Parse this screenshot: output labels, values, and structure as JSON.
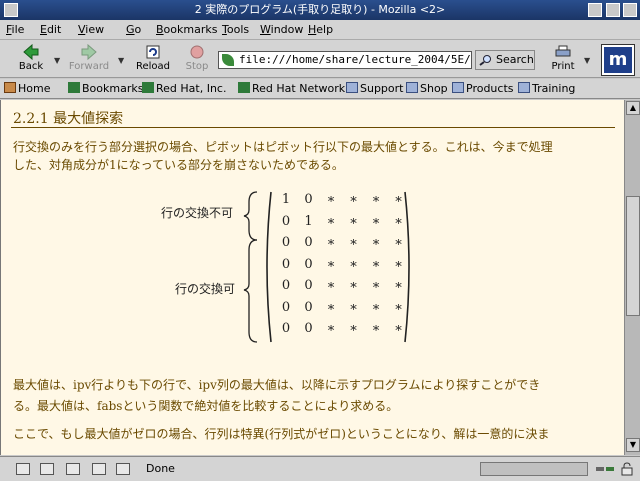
{
  "window": {
    "title": "2 実際のプログラム(手取り足取り) - Mozilla <2>"
  },
  "menu": [
    "File",
    "Edit",
    "View",
    "Go",
    "Bookmarks",
    "Tools",
    "Window",
    "Help"
  ],
  "menu_accel": [
    "F",
    "E",
    "V",
    "G",
    "B",
    "T",
    "W",
    "H"
  ],
  "menu_rest": [
    "ile",
    "dit",
    "iew",
    "o",
    "ookmarks",
    "ools",
    "indow",
    "elp"
  ],
  "nav": {
    "back": "Back",
    "forward": "Forward",
    "reload": "Reload",
    "stop": "Stop",
    "print": "Print",
    "search": "Search"
  },
  "url": "file:///home/share/lecture_2004/5E/Li",
  "bookmarks": [
    "Home",
    "Bookmarks",
    "Red Hat, Inc.",
    "Red Hat Network",
    "Support",
    "Shop",
    "Products",
    "Training"
  ],
  "logo_letter": "m",
  "content": {
    "heading": "2.2.1 最大値探索",
    "para1_line1": "行交換のみを行う部分選択の場合、ピボットはピボット行以下の最大値とする。これは、今まで処理",
    "para1_line2": "した、対角成分が1になっている部分を崩さないためである。",
    "label_no_swap": "行の交換不可",
    "label_swap": "行の交換可",
    "matrix": [
      [
        "1",
        "0",
        "∗",
        "∗",
        "∗",
        "∗"
      ],
      [
        "0",
        "1",
        "∗",
        "∗",
        "∗",
        "∗"
      ],
      [
        "0",
        "0",
        "∗",
        "∗",
        "∗",
        "∗"
      ],
      [
        "0",
        "0",
        "∗",
        "∗",
        "∗",
        "∗"
      ],
      [
        "0",
        "0",
        "∗",
        "∗",
        "∗",
        "∗"
      ],
      [
        "0",
        "0",
        "∗",
        "∗",
        "∗",
        "∗"
      ],
      [
        "0",
        "0",
        "∗",
        "∗",
        "∗",
        "∗"
      ]
    ],
    "para2_line1": "最大値は、ipv行よりも下の行で、ipv列の最大値は、以降に示すプログラムにより探すことができ",
    "para2_line2": "る。最大値は、fabsという関数で絶対値を比較することにより求める。",
    "para3_line1": "ここで、もし最大値がゼロの場合、行列は特異(行列式がゼロ)ということになり、解は一意的に決ま"
  },
  "status": {
    "text": "Done"
  },
  "colors": {
    "titlebar": "#1b3566",
    "page_bg": "#fff8e6",
    "text_brown": "#6a4a00"
  }
}
